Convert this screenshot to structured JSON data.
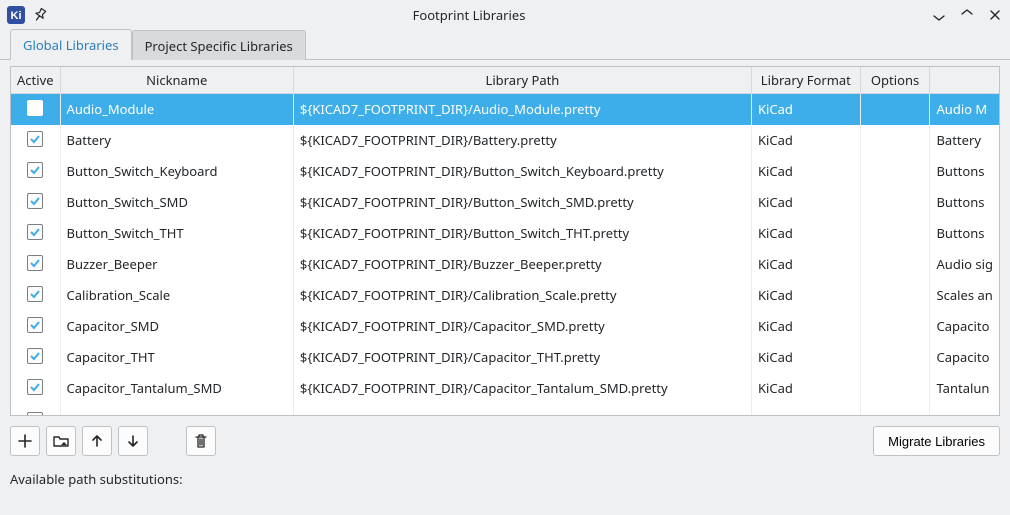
{
  "window": {
    "title": "Footprint Libraries",
    "app_icon": "kicad-icon",
    "pin_icon": "pin-icon",
    "min_icon": "minimize-icon",
    "max_icon": "maximize-icon",
    "close_icon": "close-icon"
  },
  "tabs": {
    "global": "Global Libraries",
    "project": "Project Specific Libraries"
  },
  "columns": {
    "active": "Active",
    "nickname": "Nickname",
    "path": "Library Path",
    "format": "Library Format",
    "options": "Options",
    "description": ""
  },
  "rows": [
    {
      "active": true,
      "nickname": "Audio_Module",
      "path": "${KICAD7_FOOTPRINT_DIR}/Audio_Module.pretty",
      "format": "KiCad",
      "options": "",
      "desc": "Audio M",
      "selected": true
    },
    {
      "active": true,
      "nickname": "Battery",
      "path": "${KICAD7_FOOTPRINT_DIR}/Battery.pretty",
      "format": "KiCad",
      "options": "",
      "desc": "Battery",
      "selected": false
    },
    {
      "active": true,
      "nickname": "Button_Switch_Keyboard",
      "path": "${KICAD7_FOOTPRINT_DIR}/Button_Switch_Keyboard.pretty",
      "format": "KiCad",
      "options": "",
      "desc": "Buttons",
      "selected": false
    },
    {
      "active": true,
      "nickname": "Button_Switch_SMD",
      "path": "${KICAD7_FOOTPRINT_DIR}/Button_Switch_SMD.pretty",
      "format": "KiCad",
      "options": "",
      "desc": "Buttons",
      "selected": false
    },
    {
      "active": true,
      "nickname": "Button_Switch_THT",
      "path": "${KICAD7_FOOTPRINT_DIR}/Button_Switch_THT.pretty",
      "format": "KiCad",
      "options": "",
      "desc": "Buttons",
      "selected": false
    },
    {
      "active": true,
      "nickname": "Buzzer_Beeper",
      "path": "${KICAD7_FOOTPRINT_DIR}/Buzzer_Beeper.pretty",
      "format": "KiCad",
      "options": "",
      "desc": "Audio sig",
      "selected": false
    },
    {
      "active": true,
      "nickname": "Calibration_Scale",
      "path": "${KICAD7_FOOTPRINT_DIR}/Calibration_Scale.pretty",
      "format": "KiCad",
      "options": "",
      "desc": "Scales an",
      "selected": false
    },
    {
      "active": true,
      "nickname": "Capacitor_SMD",
      "path": "${KICAD7_FOOTPRINT_DIR}/Capacitor_SMD.pretty",
      "format": "KiCad",
      "options": "",
      "desc": "Capacito",
      "selected": false
    },
    {
      "active": true,
      "nickname": "Capacitor_THT",
      "path": "${KICAD7_FOOTPRINT_DIR}/Capacitor_THT.pretty",
      "format": "KiCad",
      "options": "",
      "desc": "Capacito",
      "selected": false
    },
    {
      "active": true,
      "nickname": "Capacitor_Tantalum_SMD",
      "path": "${KICAD7_FOOTPRINT_DIR}/Capacitor_Tantalum_SMD.pretty",
      "format": "KiCad",
      "options": "",
      "desc": "Tantalun",
      "selected": false
    }
  ],
  "toolbar": {
    "add": {
      "name": "plus-icon",
      "label": "+"
    },
    "browse": {
      "name": "folder-icon"
    },
    "up": {
      "name": "arrow-up-icon"
    },
    "down": {
      "name": "arrow-down-icon"
    },
    "delete": {
      "name": "trash-icon"
    },
    "migrate_label": "Migrate Libraries"
  },
  "substitutions_label": "Available path substitutions:"
}
